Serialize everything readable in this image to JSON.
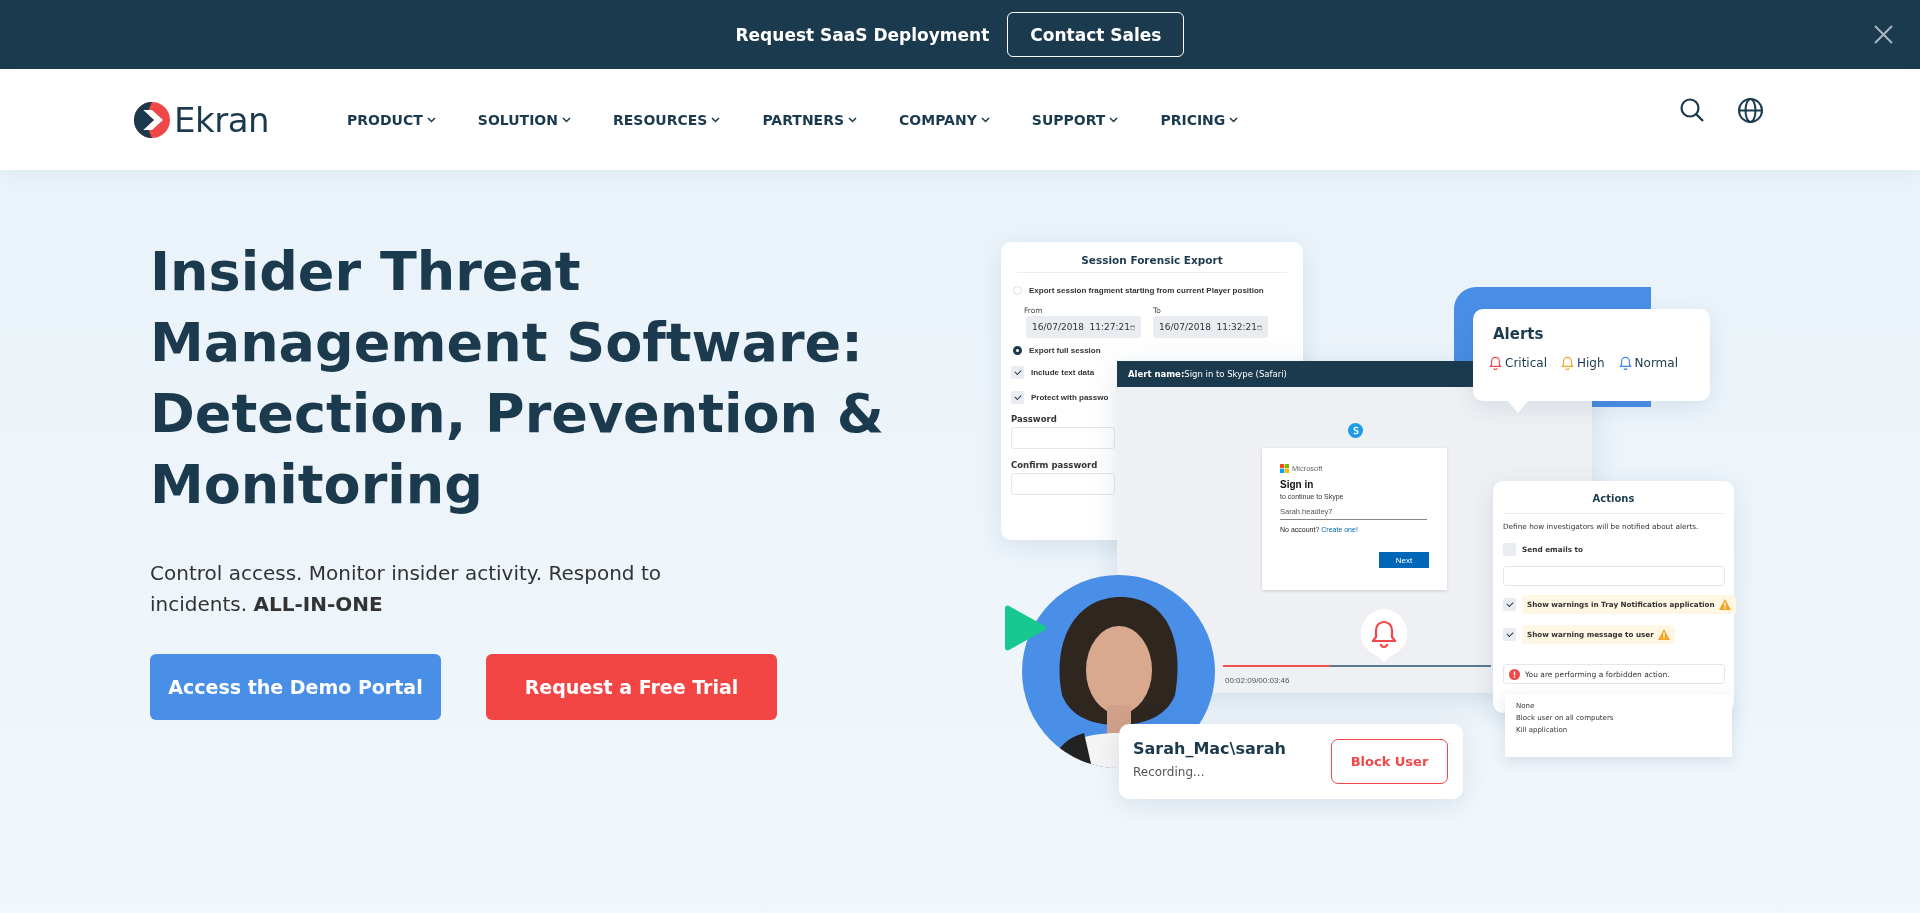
{
  "banner": {
    "text": "Request SaaS Deployment",
    "button": "Contact Sales"
  },
  "nav": {
    "logo": "Ekran",
    "items": [
      {
        "label": "PRODUCT"
      },
      {
        "label": "SOLUTION"
      },
      {
        "label": "RESOURCES"
      },
      {
        "label": "PARTNERS"
      },
      {
        "label": "COMPANY"
      },
      {
        "label": "SUPPORT"
      },
      {
        "label": "PRICING"
      }
    ]
  },
  "hero": {
    "title": [
      "Insider Threat",
      "Management Software:",
      "Detection, Prevention &",
      "Monitoring"
    ],
    "subtitle": "Control access. Monitor insider activity. Respond to incidents. **ALL-IN-ONE**",
    "buttons": [
      {
        "label": "Access the Demo Portal",
        "kind": "primary"
      },
      {
        "label": "Request a Free Trial",
        "kind": "danger"
      }
    ]
  },
  "illustration": {
    "export_panel": {
      "title": "Session Forensic Export",
      "fragment_option": {
        "label": "Export session fragment starting from current Player position",
        "selected": false
      },
      "from": {
        "label": "From",
        "value": "16/07/2018  11:27:21"
      },
      "to": {
        "label": "To",
        "value": "16/07/2018  11:32:21"
      },
      "full_option": {
        "label": "Export full session",
        "selected": true
      },
      "checks": [
        {
          "label": "Include text data",
          "checked": true
        },
        {
          "label": "Protect with passwo",
          "checked": true
        }
      ],
      "fields": [
        {
          "label": "Password"
        },
        {
          "label": "Confirm password"
        }
      ]
    },
    "alert_window": {
      "label": "Alert name:",
      "value": "Sign in to Skype (Safari)",
      "signin": {
        "brand": "Microsoft",
        "title": "Sign in",
        "subtitle": "to continue to Skype",
        "value": "Sarah.headley7",
        "prompt": "No account?",
        "link": "Create one!",
        "button": "Next"
      },
      "progress": {
        "level": 0.4
      },
      "time": "00:02:09/00:03:46"
    },
    "alerts": {
      "title": "Alerts",
      "levels": [
        {
          "label": "Critical",
          "color": "#f04848"
        },
        {
          "label": "High",
          "color": "#f5a524"
        },
        {
          "label": "Normal",
          "color": "#3d86e8"
        }
      ]
    },
    "actions": {
      "title": "Actions",
      "description": "Define how investigators will be notified about alerts.",
      "email": {
        "label": "Send emails to",
        "checked": false
      },
      "warnings": [
        {
          "label": "Show warnings in Tray Notificatios application",
          "checked": true
        },
        {
          "label": "Show warning message to user",
          "checked": true
        }
      ],
      "message": "You are performing a forbidden action.",
      "menu": [
        "None",
        "Block user on all computers",
        "Kill application"
      ]
    },
    "user": {
      "name": "Sarah_Mac\\sarah",
      "status": "Recording...",
      "button": "Block User"
    }
  }
}
